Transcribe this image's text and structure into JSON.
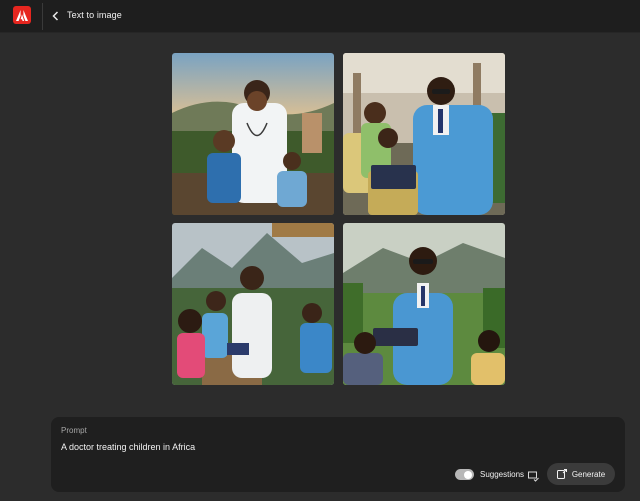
{
  "header": {
    "app_icon": "adobe-logo",
    "back_icon": "chevron-left-icon",
    "title": "Text to image"
  },
  "gallery": {
    "images": [
      {
        "description_icon": "generated-image"
      },
      {
        "description_icon": "generated-image"
      },
      {
        "description_icon": "generated-image"
      },
      {
        "description_icon": "generated-image"
      }
    ]
  },
  "prompt": {
    "label": "Prompt",
    "value": "A doctor treating children in Africa",
    "suggestions_label": "Suggestions",
    "suggestions_on": true,
    "generate_label": "Generate"
  },
  "colors": {
    "brand": "#e6261f",
    "background": "#2c2c2c",
    "panel": "#1f1f1f"
  }
}
